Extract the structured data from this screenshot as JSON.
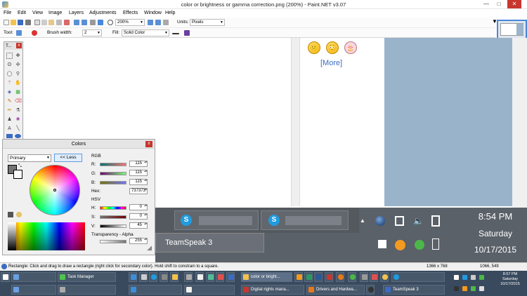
{
  "window": {
    "title": "color or brightness or gamma correction.png (200%) - Paint.NET v3.07",
    "minimize": "—",
    "maximize": "□",
    "close": "✕"
  },
  "menu": [
    "File",
    "Edit",
    "View",
    "Image",
    "Layers",
    "Adjustments",
    "Effects",
    "Window",
    "Help"
  ],
  "toolbar1": {
    "zoom": "200%",
    "units_label": "Units:",
    "units": "Pixels"
  },
  "toolbar2": {
    "tool_label": "Tool:",
    "brush_label": "Brush width:",
    "brush_width": "2",
    "fill_label": "Fill:",
    "fill": "Solid Color"
  },
  "canvas": {
    "more_link": "[More]",
    "emojis": [
      "😕",
      "😳",
      "🎂"
    ]
  },
  "tools_panel": {
    "title": "T...",
    "close": "x"
  },
  "colors_panel": {
    "title": "Colors",
    "close": "x",
    "mode": "Primary",
    "less_button": "<< Less",
    "rgb_label": "RGB",
    "r_label": "R:",
    "r": "115",
    "g_label": "G:",
    "g": "115",
    "b_label": "B:",
    "b": "115",
    "hex_label": "Hex:",
    "hex": "737373",
    "hsv_label": "HSV",
    "h_label": "H:",
    "h": "0",
    "s_label": "S:",
    "s": "0",
    "v_label": "V:",
    "v": "45",
    "alpha_label": "Transparency - Alpha",
    "alpha": "255"
  },
  "embedded": {
    "time": "8:54 PM",
    "day": "Saturday",
    "date": "10/17/2015",
    "teamspeak": "TeamSpeak 3"
  },
  "status": {
    "hint": "Rectangle: Click and drag to draw a rectangle (right click for secondary color). Hold shift to constrain to a square.",
    "size": "1366 x 768",
    "cursor": "1066, 549"
  },
  "taskbar": {
    "task_manager": "Task Manager",
    "paintnet": "color or bright...",
    "drm": "Digital rights mana...",
    "drivers": "Drivers and Hardwa...",
    "teamspeak": "TeamSpeak 3",
    "time": "8:57 PM",
    "day": "Saturday",
    "date": "10/17/2015"
  },
  "colors": {
    "accent": "#4a88d9",
    "canvas_blue": "#99b3cb",
    "primary_color": "#737373",
    "taskbar": "#394a5e"
  }
}
